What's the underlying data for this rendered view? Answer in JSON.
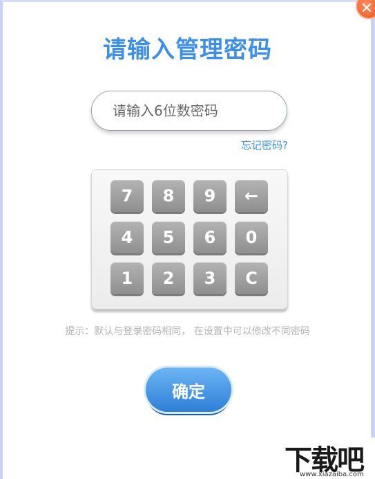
{
  "dialog": {
    "title": "请输入管理密码",
    "close_icon": "close-icon"
  },
  "password": {
    "placeholder": "请输入6位数密码",
    "value": ""
  },
  "forgot_link": "忘记密码?",
  "keypad": {
    "keys": [
      {
        "id": "key-7",
        "label": "7"
      },
      {
        "id": "key-8",
        "label": "8"
      },
      {
        "id": "key-9",
        "label": "9"
      },
      {
        "id": "key-backspace",
        "label": "←"
      },
      {
        "id": "key-4",
        "label": "4"
      },
      {
        "id": "key-5",
        "label": "5"
      },
      {
        "id": "key-6",
        "label": "6"
      },
      {
        "id": "key-0",
        "label": "0"
      },
      {
        "id": "key-1",
        "label": "1"
      },
      {
        "id": "key-2",
        "label": "2"
      },
      {
        "id": "key-3",
        "label": "3"
      },
      {
        "id": "key-clear",
        "label": "C"
      }
    ]
  },
  "hint": "提示：默认与登录密码相同， 在设置中可以修改不同密码",
  "confirm_label": "确定",
  "watermark": {
    "logo": "下载吧",
    "url": "www.xiazaiba.com"
  },
  "colors": {
    "accent": "#3d8ee6",
    "key_gray": "#a0a0a0",
    "close": "#e8541f"
  }
}
